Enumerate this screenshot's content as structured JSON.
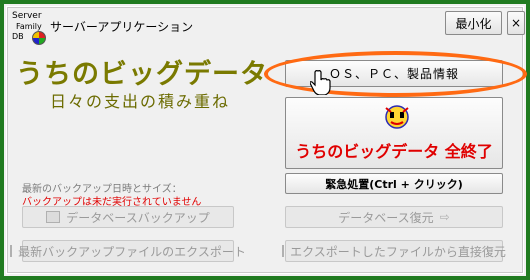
{
  "window": {
    "logo_lines": [
      "Server",
      "Family",
      "DB"
    ],
    "app_title": "サーバーアプリケーション",
    "minimize_label": "最小化",
    "close_label": "×"
  },
  "header": {
    "main_title": "うちのビッグデータ",
    "subtitle": "日々の支出の積み重ね"
  },
  "buttons": {
    "os_pc_info": "ＯＳ、ＰＣ、製品情報",
    "exit_all": "うちのビッグデータ 全終了",
    "emergency": "緊急処置(Ctrl + クリック)",
    "db_backup": "データベースバックアップ",
    "export_latest": "最新バックアップファイルのエクスポート",
    "db_restore": "データベース復元",
    "direct_restore": "エクスポートしたファイルから直接復元"
  },
  "backup": {
    "label": "最新のバックアップ日時とサイズ：",
    "status": "バックアップは未だ実行されていません"
  },
  "colors": {
    "frame": "#1f7a1f",
    "title_olive": "#7a7a00",
    "accent_red": "#e00000",
    "highlight_orange": "#ff6a13"
  },
  "icons": {
    "cursor": "hand-pointer-icon",
    "exit": "face-exit-icon"
  }
}
